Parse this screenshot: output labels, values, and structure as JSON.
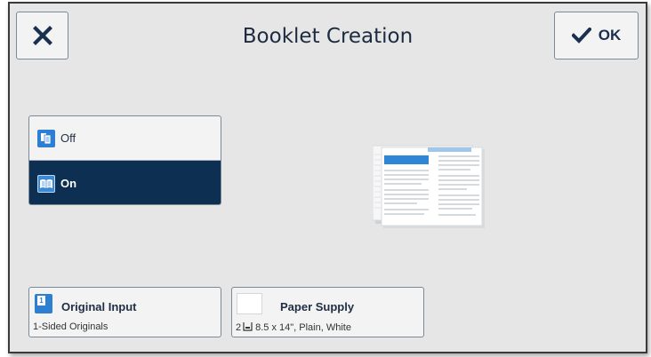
{
  "header": {
    "title": "Booklet Creation",
    "close_icon": "close-x-icon",
    "ok_label": "OK",
    "ok_icon": "checkmark-icon"
  },
  "booklet_options": {
    "selected": "On",
    "items": [
      {
        "label": "Off",
        "icon": "single-page-icon",
        "selected": false
      },
      {
        "label": "On",
        "icon": "open-booklet-icon",
        "selected": true
      }
    ]
  },
  "preview": {
    "icon": "booklet-illustration"
  },
  "original_input": {
    "title": "Original Input",
    "value": "1-Sided Originals",
    "icon": "one-sided-document-icon",
    "icon_text": "1"
  },
  "paper_supply": {
    "title": "Paper Supply",
    "tray_number": "2",
    "tray_icon": "paper-tray-icon",
    "value": "8.5 x 14\", Plain, White"
  },
  "colors": {
    "selected_bg": "#0c2f52",
    "accent_blue": "#2d7fd1",
    "panel_bg": "#e6e6e6",
    "button_bg": "#f3f3f3",
    "border": "#7d8996"
  }
}
